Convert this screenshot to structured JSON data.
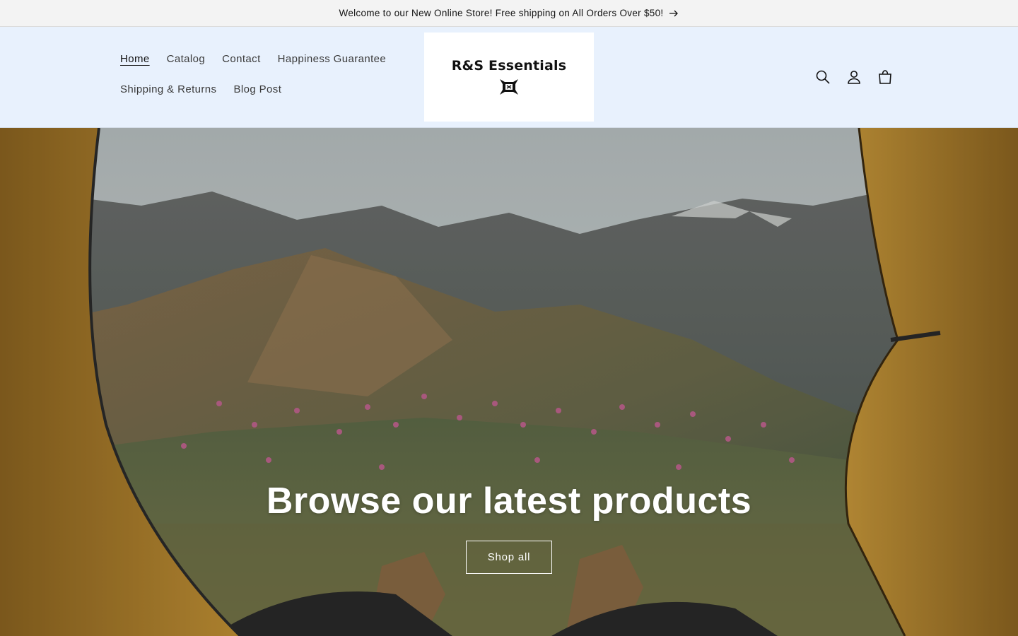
{
  "announcement": {
    "text": "Welcome to our New Online Store! Free shipping on All Orders Over $50!",
    "icon": "arrow-right-icon"
  },
  "header": {
    "nav": [
      {
        "label": "Home",
        "active": true
      },
      {
        "label": "Catalog"
      },
      {
        "label": "Contact"
      },
      {
        "label": "Happiness Guarantee"
      },
      {
        "label": "Shipping & Returns"
      },
      {
        "label": "Blog Post"
      }
    ],
    "logo": {
      "text": "R&S Essentials",
      "icon": "logo-mark-icon"
    },
    "icons": [
      "search-icon",
      "account-icon",
      "cart-icon"
    ]
  },
  "hero": {
    "title": "Browse our latest products",
    "button": "Shop all"
  },
  "colors": {
    "announcement_bg": "#f3f3f3",
    "header_bg": "#e8f1fd",
    "tent": "#b8862e",
    "text_dark": "#121212"
  }
}
